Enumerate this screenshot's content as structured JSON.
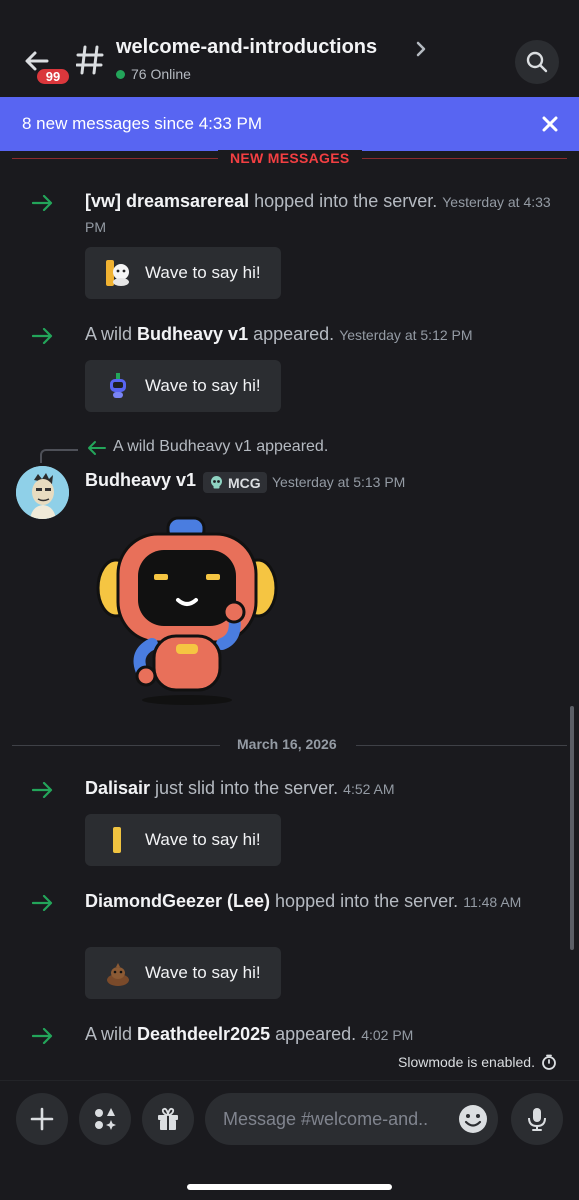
{
  "header": {
    "unread_count": "99",
    "channel_name": "welcome-and-introductions",
    "online_text": "76 Online"
  },
  "banner": {
    "text": "8 new messages since 4:33 PM"
  },
  "new_messages_label": "NEW MESSAGES",
  "messages": [
    {
      "pre": "",
      "name": "[vw] dreamsarereal",
      "post": " hopped into the server.",
      "time": "Yesterday at 4:33 PM",
      "wave_label": "Wave to say hi!"
    },
    {
      "pre": "A wild ",
      "name": "Budheavy v1",
      "post": " appeared.",
      "time": "Yesterday at 5:12 PM",
      "wave_label": "Wave to say hi!"
    },
    {
      "pre": "",
      "name": "Dalisair",
      "post": " just slid into the server.",
      "time": "4:52 AM",
      "wave_label": "Wave to say hi!"
    },
    {
      "pre": "",
      "name": "DiamondGeezer (Lee)",
      "post": " hopped into the server.",
      "time": "11:48 AM",
      "wave_label": "Wave to say hi!"
    },
    {
      "pre": "A wild ",
      "name": "Deathdeelr2025",
      "post": " appeared.",
      "time": "4:02 PM",
      "wave_label": ""
    }
  ],
  "reply": {
    "reference_text": "A wild Budheavy v1 appeared.",
    "author": "Budheavy v1",
    "tag": "MCG",
    "time": "Yesterday at 5:13 PM"
  },
  "date_divider": "March 16, 2026",
  "slowmode_text": "Slowmode is enabled.",
  "composer": {
    "placeholder": "Message #welcome-and.."
  },
  "colors": {
    "accent": "#5865f2",
    "new_messages": "#f23f42",
    "online": "#23a55a",
    "badge": "#da373c",
    "join_arrow": "#23a55a"
  },
  "icons": [
    "back-arrow-icon",
    "hash-icon",
    "chevron-right-icon",
    "search-icon",
    "close-icon",
    "join-arrow-icon",
    "reply-arrow-icon",
    "skull-icon",
    "timer-icon",
    "plus-icon",
    "apps-icon",
    "gift-icon",
    "emoji-icon",
    "microphone-icon"
  ]
}
